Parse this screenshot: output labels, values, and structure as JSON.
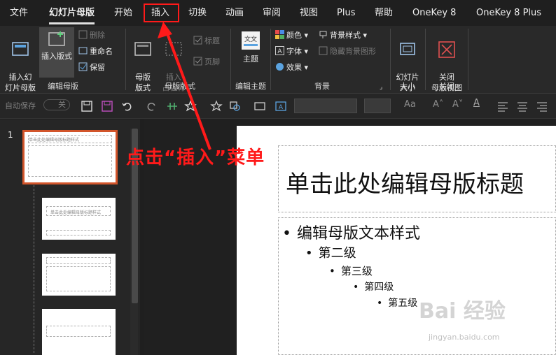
{
  "menu": {
    "tabs": [
      {
        "label": "文件"
      },
      {
        "label": "幻灯片母版"
      },
      {
        "label": "开始"
      },
      {
        "label": "插入"
      },
      {
        "label": "切换"
      },
      {
        "label": "动画"
      },
      {
        "label": "审阅"
      },
      {
        "label": "视图"
      },
      {
        "label": "Plus"
      },
      {
        "label": "帮助"
      },
      {
        "label": "OneKey 8"
      },
      {
        "label": "OneKey 8 Plus"
      }
    ],
    "active_tab": "幻灯片母版",
    "highlighted_tab": "插入"
  },
  "ribbon": {
    "edit_master": {
      "insert_slide_master": "插入幻\n灯片母版",
      "insert_layout": "插入版式",
      "delete": "删除",
      "rename": "重命名",
      "preserve": "保留",
      "group_label": "编辑母版"
    },
    "master_layout": {
      "master_layout_btn": "母版\n版式",
      "insert_placeholder": "插入\n占位符",
      "title_check": "标题",
      "footer_check": "页脚",
      "group_label": "母版版式"
    },
    "edit_theme": {
      "themes": "主题",
      "group_label": "编辑主题"
    },
    "background": {
      "colors": "颜色",
      "fonts": "字体",
      "effects": "效果",
      "background_styles": "背景样式",
      "hide_background": "隐藏背景图形",
      "group_label": "背景"
    },
    "size": {
      "slide_size": "幻灯片\n大小",
      "group_label": "大小"
    },
    "close": {
      "close_master_view": "关闭\n母版视图",
      "group_label": "关闭"
    }
  },
  "qat": {
    "autosave_label": "自动保存",
    "autosave_state": "关",
    "font_size_label": "Aa"
  },
  "thumbnails": {
    "slide_number": "1",
    "master_title": "单击此处编辑母版标题样式",
    "layout_title": "单击此处编辑母版标题样式"
  },
  "slide": {
    "title": "单击此处编辑母版标题",
    "levels": [
      "编辑母版文本样式",
      "第二级",
      "第三级",
      "第四级",
      "第五级"
    ],
    "bullet": "•"
  },
  "annotation": {
    "text": "点击“插入”菜单",
    "color": "#ff1a1a"
  },
  "watermark": {
    "logo": "Bai 经验",
    "url": "jingyan.baidu.com"
  }
}
